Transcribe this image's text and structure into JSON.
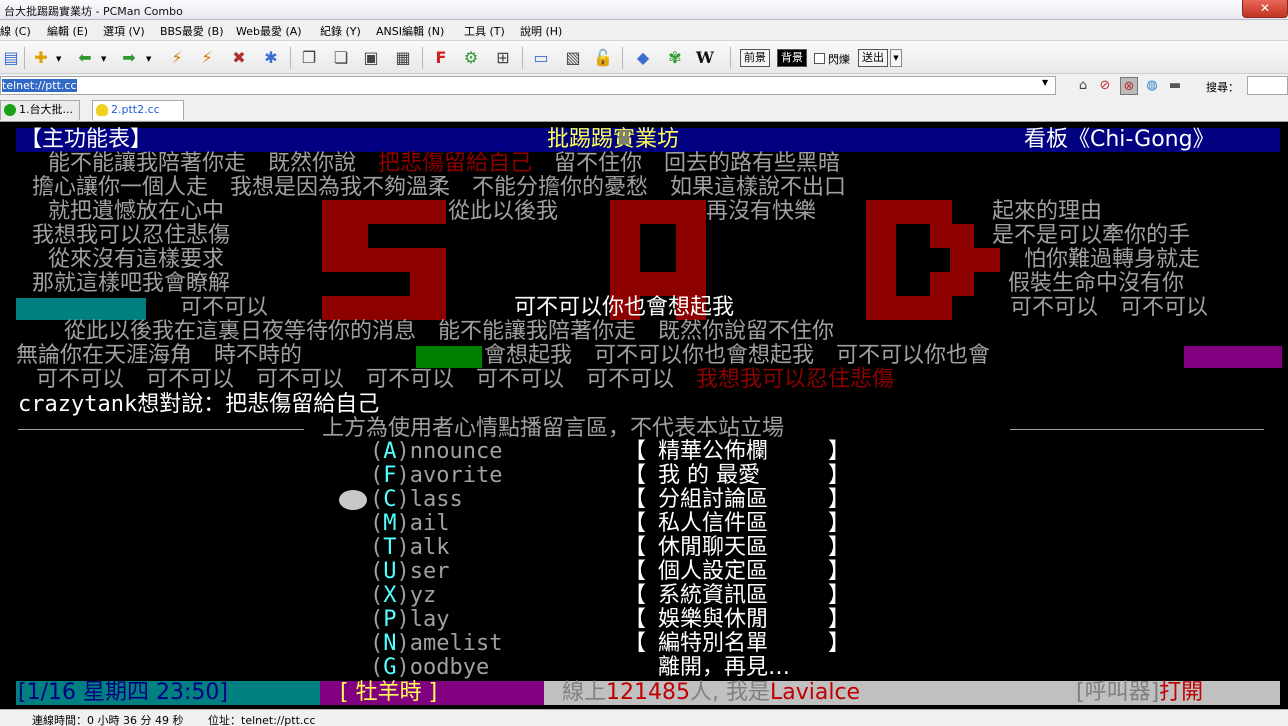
{
  "window": {
    "title": "台大批踢踢實業坊 - PCMan Combo",
    "close_label": "✕"
  },
  "menu": [
    "線 (C)",
    "編輯 (E)",
    "選項 (V)",
    "BBS最愛 (B)",
    "Web最愛 (A)",
    "紀錄 (Y)",
    "ANSI編輯 (N)",
    "工具 (T)",
    "說明 (H)"
  ],
  "toolbar": {
    "fg_label": "前景",
    "bg_label": "背景",
    "blink_label": "閃爍",
    "send_label": "送出"
  },
  "address": {
    "value": "telnet://ptt.cc",
    "search_label": "搜尋："
  },
  "tabs": [
    {
      "label": "1.台大批..."
    },
    {
      "label": "2.ptt2.cc"
    }
  ],
  "bbs": {
    "header": {
      "left": "【主功能表】",
      "center": "批踢踢實業坊",
      "right": "看板《Chi-Gong》"
    },
    "art_lines": [
      {
        "segs": [
          {
            "t": "能不能讓我陪著你走　既然你說　",
            "c": "gray"
          },
          {
            "t": "把悲傷留給自己",
            "c": "dred"
          },
          {
            "t": "　留不住你　回去的路有些黑暗",
            "c": "gray"
          }
        ]
      },
      {
        "segs": [
          {
            "t": "擔心讓你一個人走　我想是因為我不夠溫柔　不能分擔你的憂愁　如果這樣說不出口",
            "c": "gray"
          }
        ]
      },
      {
        "segs": [
          {
            "t": "就把遺憾放在心中",
            "c": "gray"
          }
        ]
      },
      {
        "segs": [
          {
            "t": "從此以後我",
            "c": "gray"
          }
        ]
      },
      {
        "segs": [
          {
            "t": "再沒有快樂",
            "c": "gray"
          }
        ]
      },
      {
        "segs": [
          {
            "t": "起來的理由",
            "c": "gray"
          }
        ]
      },
      {
        "segs": [
          {
            "t": "我想我可以忍住悲傷",
            "c": "gray"
          }
        ]
      },
      {
        "segs": [
          {
            "t": "是不是可以牽你的手",
            "c": "gray"
          }
        ]
      },
      {
        "segs": [
          {
            "t": "從來沒有這樣要求",
            "c": "gray"
          }
        ]
      },
      {
        "segs": [
          {
            "t": "怕你難過轉身就走",
            "c": "gray"
          }
        ]
      },
      {
        "segs": [
          {
            "t": "那就這樣吧我會瞭解",
            "c": "gray"
          }
        ]
      },
      {
        "segs": [
          {
            "t": "假裝生命中沒有你",
            "c": "gray"
          }
        ]
      },
      {
        "segs": [
          {
            "t": "可不可以",
            "c": "gray"
          }
        ]
      },
      {
        "segs": [
          {
            "t": "可不可以你也會想起我",
            "c": "white"
          }
        ]
      },
      {
        "segs": [
          {
            "t": "可不可以　可不可以",
            "c": "gray"
          }
        ]
      },
      {
        "segs": [
          {
            "t": "從此以後我在這裏日夜等待你的消息　能不能讓我陪著你走　既然你說留不住你",
            "c": "gray"
          }
        ]
      },
      {
        "segs": [
          {
            "t": "無論你在天涯海角　時不時的",
            "c": "gray"
          }
        ]
      },
      {
        "segs": [
          {
            "t": "會想起我　可不可以你也會想起我　可不可以你也會",
            "c": "gray"
          }
        ]
      },
      {
        "segs": [
          {
            "t": "可不可以　可不可以　可不可以　可不可以　可不可以　可不可以　",
            "c": "gray"
          },
          {
            "t": "我想我可以忍住悲傷",
            "c": "dred"
          }
        ]
      }
    ],
    "mood": {
      "user": "crazytank",
      "mid": "想對說：",
      "msg": "把悲傷留給自己"
    },
    "divider": "上方為使用者心情點播留言區，不代表本站立場",
    "menu_items": [
      {
        "key": "A",
        "rest": "nnounce",
        "desc": "精華公佈欄"
      },
      {
        "key": "F",
        "rest": "avorite",
        "desc": "我 的 最愛"
      },
      {
        "key": "C",
        "rest": "lass",
        "desc": "分組討論區"
      },
      {
        "key": "M",
        "rest": "ail",
        "desc": "私人信件區"
      },
      {
        "key": "T",
        "rest": "alk",
        "desc": "休閒聊天區"
      },
      {
        "key": "U",
        "rest": "ser",
        "desc": "個人設定區"
      },
      {
        "key": "X",
        "rest": "yz",
        "desc": "系統資訊區"
      },
      {
        "key": "P",
        "rest": "lay",
        "desc": "娛樂與休閒"
      },
      {
        "key": "N",
        "rest": "amelist",
        "desc": "編特別名單"
      },
      {
        "key": "G",
        "rest": "oodbye",
        "desc": "離開，再見…"
      }
    ],
    "bracket_left": "【",
    "bracket_right": "】",
    "statusbar": {
      "date": "[1/16 星期四 23:50]",
      "hour": "[ 牡羊時 ]",
      "online_prefix": "線上",
      "online_count": "121485",
      "online_mid": "人, 我是",
      "username": "Lavialce",
      "pager_label": "[呼叫器]",
      "pager_state": "打開"
    }
  },
  "statusline": {
    "conn": "連線時間：0 小時 36 分 49 秒",
    "pos": "位址：telnet://ptt.cc"
  },
  "colors": {
    "header_bg": "#000080",
    "art_red": "#8d0000",
    "teal": "#008080",
    "green": "#008000",
    "purple": "#800080",
    "status_blue": "#008080",
    "status_purple": "#800080",
    "status_gray": "#c0c0c0"
  }
}
